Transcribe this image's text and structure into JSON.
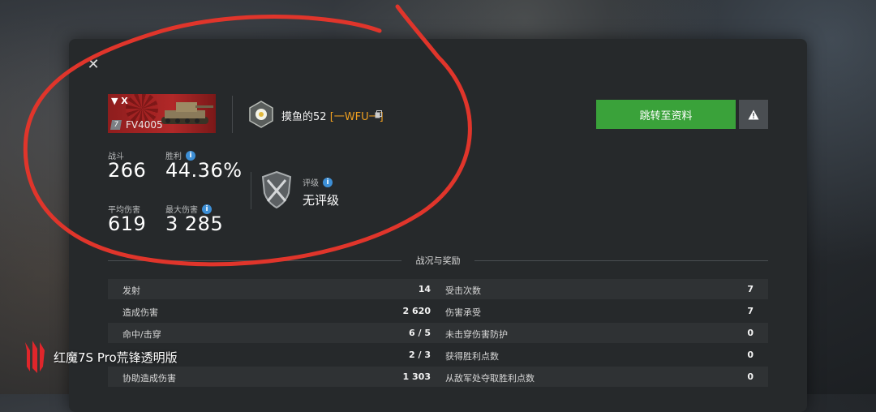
{
  "close_icon": "close-icon",
  "tank": {
    "tier": "7",
    "name": "FV4005",
    "rank_mark": "▼ X"
  },
  "player": {
    "name": "摸鱼的52",
    "clan": "[一WFU一]"
  },
  "buttons": {
    "goto_profile": "跳转至资料",
    "report_icon": "warning-icon"
  },
  "stats": {
    "battles_label": "战斗",
    "battles_value": "266",
    "winrate_label": "胜利",
    "winrate_value": "44.36%",
    "avg_damage_label": "平均伤害",
    "avg_damage_value": "619",
    "max_damage_label": "最大伤害",
    "max_damage_value": "3 285",
    "rating_label": "评级",
    "rating_value": "无评级"
  },
  "section_title": "战况与奖励",
  "table_rows": [
    {
      "l_label": "发射",
      "l_value": "14",
      "r_label": "受击次数",
      "r_value": "7"
    },
    {
      "l_label": "造成伤害",
      "l_value": "2 620",
      "r_label": "伤害承受",
      "r_value": "7"
    },
    {
      "l_label": "命中/击穿",
      "l_value": "6 / 5",
      "r_label": "未击穿伤害防护",
      "r_value": "0"
    },
    {
      "l_label": "",
      "l_value": "2 / 3",
      "r_label": "获得胜利点数",
      "r_value": "0"
    },
    {
      "l_label": "协助造成伤害",
      "l_value": "1 303",
      "r_label": "从敌军处夺取胜利点数",
      "r_value": "0"
    }
  ],
  "watermark": {
    "text": "红魔7S Pro荒锋透明版"
  },
  "colors": {
    "accent_green": "#3aa23a",
    "annotation_red": "#e0352b",
    "clan_orange": "#f0a020",
    "info_blue": "#3d8fd6"
  }
}
